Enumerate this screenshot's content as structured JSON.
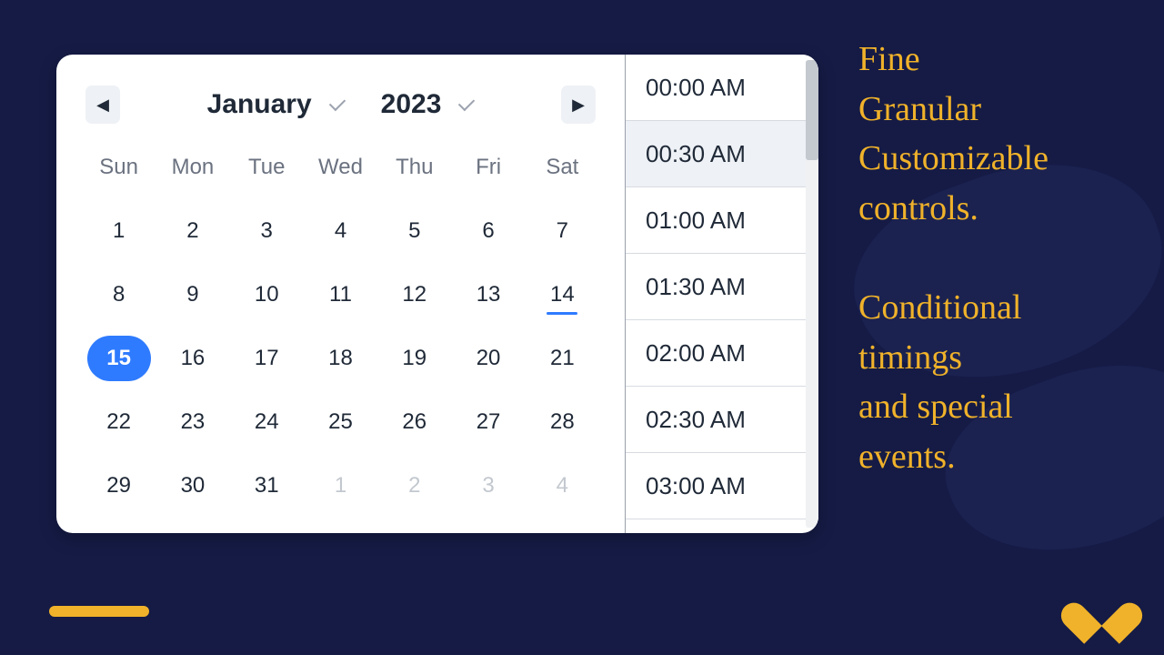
{
  "calendar": {
    "month": "January",
    "year": "2023",
    "dow": [
      "Sun",
      "Mon",
      "Tue",
      "Wed",
      "Thu",
      "Fri",
      "Sat"
    ],
    "today": 14,
    "selected": 15,
    "weeks": [
      [
        {
          "n": 1
        },
        {
          "n": 2
        },
        {
          "n": 3
        },
        {
          "n": 4
        },
        {
          "n": 5
        },
        {
          "n": 6
        },
        {
          "n": 7
        }
      ],
      [
        {
          "n": 8
        },
        {
          "n": 9
        },
        {
          "n": 10
        },
        {
          "n": 11
        },
        {
          "n": 12
        },
        {
          "n": 13
        },
        {
          "n": 14
        }
      ],
      [
        {
          "n": 15
        },
        {
          "n": 16
        },
        {
          "n": 17
        },
        {
          "n": 18
        },
        {
          "n": 19
        },
        {
          "n": 20
        },
        {
          "n": 21
        }
      ],
      [
        {
          "n": 22
        },
        {
          "n": 23
        },
        {
          "n": 24
        },
        {
          "n": 25
        },
        {
          "n": 26
        },
        {
          "n": 27
        },
        {
          "n": 28
        }
      ],
      [
        {
          "n": 29
        },
        {
          "n": 30
        },
        {
          "n": 31
        },
        {
          "n": 1,
          "out": true
        },
        {
          "n": 2,
          "out": true
        },
        {
          "n": 3,
          "out": true
        },
        {
          "n": 4,
          "out": true
        }
      ]
    ]
  },
  "times": {
    "hovered_index": 1,
    "slots": [
      "00:00 AM",
      "00:30 AM",
      "01:00 AM",
      "01:30 AM",
      "02:00 AM",
      "02:30 AM",
      "03:00 AM"
    ]
  },
  "copy": {
    "p1_l1": "Fine",
    "p1_l2": "Granular",
    "p1_l3": "Customizable",
    "p1_l4": "controls.",
    "p2_l1": "Conditional",
    "p2_l2": "timings",
    "p2_l3": "and special",
    "p2_l4": "events."
  },
  "colors": {
    "bg": "#151b45",
    "accent": "#f0b22a",
    "primary": "#2f7bff"
  }
}
